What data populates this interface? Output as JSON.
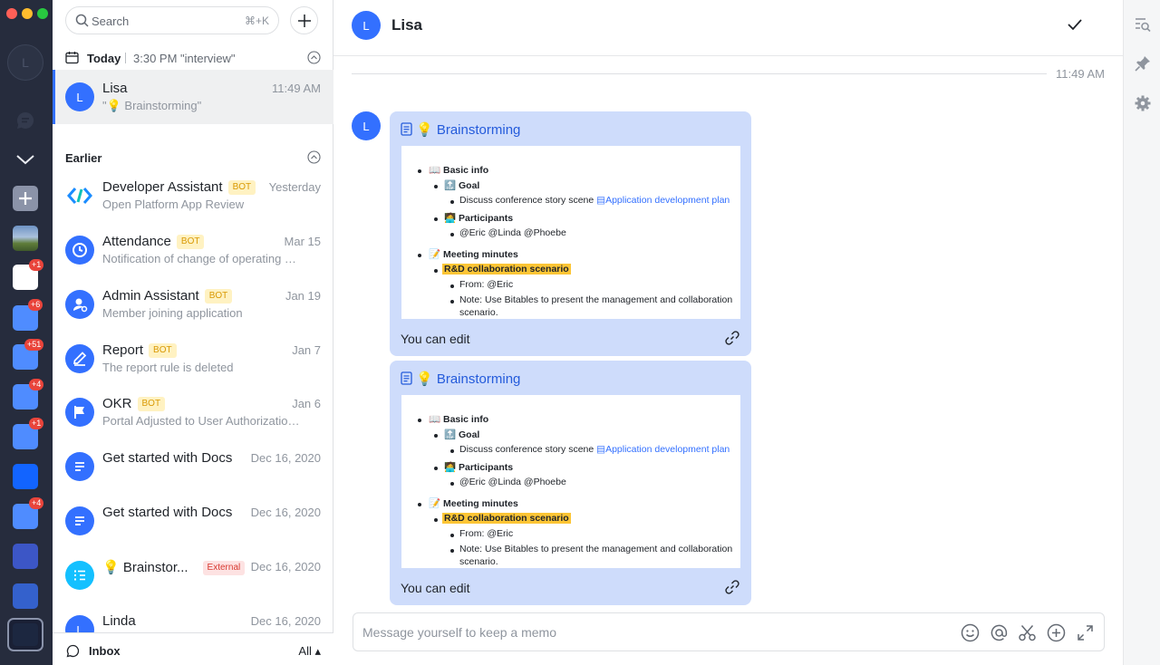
{
  "rail": {
    "avatar_letter": "L",
    "badges": [
      "+1",
      "+6",
      "+51",
      "+4",
      "+1",
      "+4"
    ]
  },
  "search": {
    "placeholder": "Search",
    "shortcut": "⌘+K"
  },
  "today": {
    "label": "Today",
    "meta": "3:30 PM \"interview\""
  },
  "earlier_label": "Earlier",
  "active_chat": {
    "avatar": "L",
    "title": "Lisa",
    "subtitle": "\"💡 Brainstorming\"",
    "time": "11:49 AM"
  },
  "chats": [
    {
      "title": "Developer Assistant",
      "tag": "BOT",
      "subtitle": "Open Platform App Review",
      "time": "Yesterday"
    },
    {
      "title": "Attendance",
      "tag": "BOT",
      "subtitle": "Notification of change of operating e...",
      "time": "Mar 15"
    },
    {
      "title": "Admin Assistant",
      "tag": "BOT",
      "subtitle": "Member joining application",
      "time": "Jan 19"
    },
    {
      "title": "Report",
      "tag": "BOT",
      "subtitle": "The report rule is deleted",
      "time": "Jan 7"
    },
    {
      "title": "OKR",
      "tag": "BOT",
      "subtitle": "Portal Adjusted to User Authorization...",
      "time": "Jan 6"
    },
    {
      "title": "Get started with Docs",
      "time": "Dec 16, 2020"
    },
    {
      "title": "Get started with Docs",
      "time": "Dec 16, 2020"
    },
    {
      "title": "💡 Brainstor...",
      "tag": "External",
      "time": "Dec 16, 2020"
    },
    {
      "title": "Linda",
      "time": "Dec 16, 2020"
    }
  ],
  "footer": {
    "inbox": "Inbox",
    "filter": "All ▴"
  },
  "chat": {
    "title": "Lisa",
    "avatar": "L",
    "divider_time": "11:49 AM",
    "cards": [
      {
        "title": "💡 Brainstorming",
        "footer": "You can edit"
      },
      {
        "title": "💡 Brainstorming",
        "footer": "You can edit"
      }
    ],
    "doc": {
      "basic_info": "📖 Basic info",
      "goal": "🔝 Goal",
      "goal_text": "Discuss conference story scene",
      "goal_link": "Application development plan",
      "participants": "🧑‍💻 Participants",
      "participants_text": "@Eric @Linda @Phoebe",
      "minutes": "📝 Meeting minutes",
      "scenario": "R&D collaboration scenario",
      "from": "From: @Eric",
      "note": "Note: Use Bitables to present the management and collaboration",
      "note2": "scenario."
    },
    "composer_placeholder": "Message yourself to keep a memo"
  }
}
